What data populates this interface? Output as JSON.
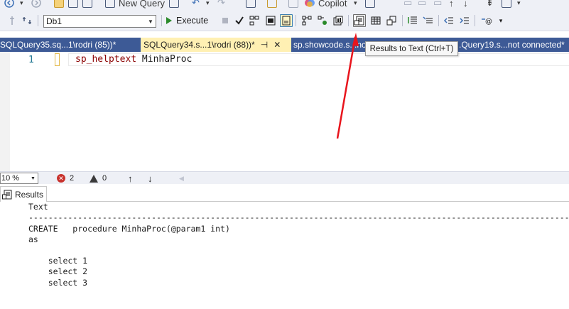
{
  "toolbar": {
    "new_query_label": "New Query",
    "copilot_label": "Copilot",
    "database_selected": "Db1",
    "execute_label": "Execute"
  },
  "tabs": [
    {
      "label": "SQLQuery35.sq...1\\rodri (85))*"
    },
    {
      "label": "SQLQuery34.s...1\\rodri (88))*",
      "active": true,
      "pin": "⊣",
      "close": "✕"
    },
    {
      "label": "sp.showcode.s...not"
    },
    {
      "label": ".Query19.s...not connected*"
    }
  ],
  "tooltip": "Results to Text (Ctrl+T)",
  "editor": {
    "line_number": "1",
    "code_proc": "sp_helptext",
    "code_arg": "MinhaProc"
  },
  "status": {
    "zoom": "10 %",
    "errors": "2",
    "warnings": "0"
  },
  "results": {
    "tab_label": "Results",
    "lines": [
      "Text",
      "-----------------------------------------------------------------------------------------------------------------",
      "CREATE   procedure MinhaProc(@param1 int)",
      "as",
      "",
      "    select 1",
      "    select 2",
      "    select 3"
    ]
  },
  "colors": {
    "tab_strip": "#3d5a96",
    "active_tab": "#fff0b3",
    "arrow": "#e8141c",
    "keyword": "#8b0000"
  }
}
